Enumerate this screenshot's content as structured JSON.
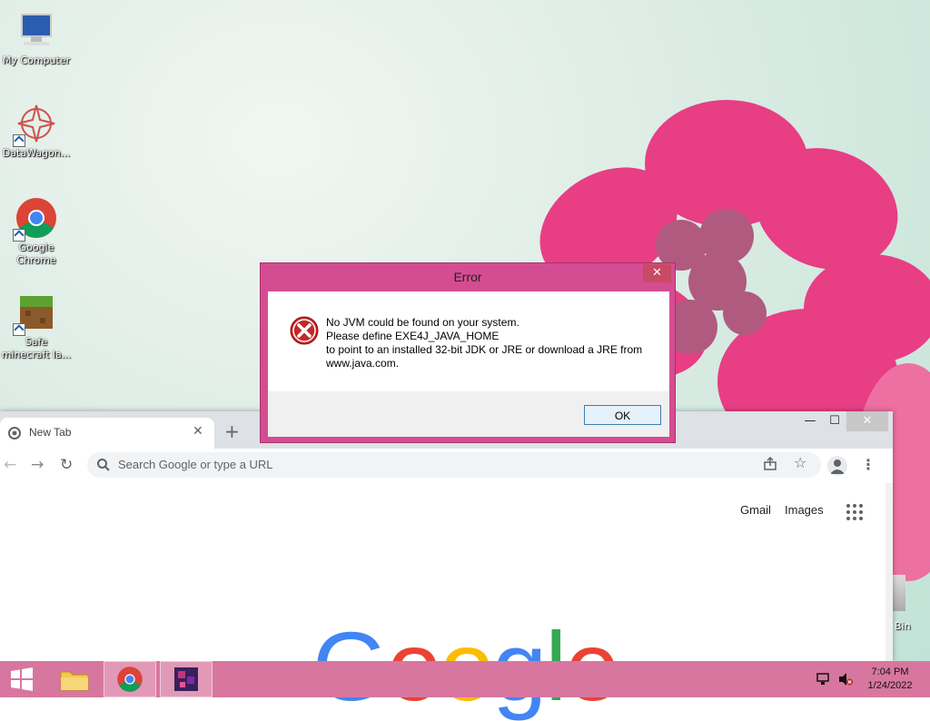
{
  "desktop": {
    "icons": [
      {
        "label": "My Computer",
        "icon": "computer-icon"
      },
      {
        "label": "DataWagon...",
        "icon": "datawagon-icon"
      },
      {
        "label": "Google\nChrome",
        "icon": "chrome-icon"
      },
      {
        "label": "Safe\nminecraft la...",
        "icon": "minecraft-icon"
      }
    ],
    "recycle_bin_partial_label": "Bin"
  },
  "chrome": {
    "tab_title": "New Tab",
    "omnibox_placeholder": "Search Google or type a URL",
    "links": {
      "gmail": "Gmail",
      "images": "Images"
    },
    "logo": [
      "G",
      "o",
      "o",
      "g",
      "l",
      "e"
    ],
    "logo_colors": [
      "#4285F4",
      "#EA4335",
      "#FBBC05",
      "#4285F4",
      "#34A853",
      "#EA4335"
    ]
  },
  "dialog": {
    "title": "Error",
    "message_lines": [
      "No JVM could be found on your system.",
      "Please define EXE4J_JAVA_HOME",
      "to point to an installed 32-bit JDK or JRE or download a JRE from",
      "www.java.com."
    ],
    "ok_label": "OK"
  },
  "taskbar": {
    "time": "7:04 PM",
    "date": "1/24/2022"
  }
}
